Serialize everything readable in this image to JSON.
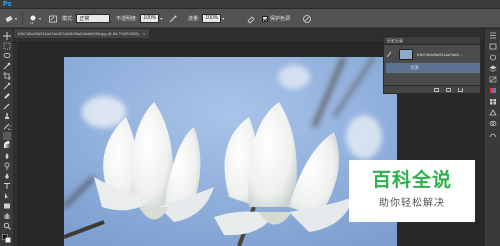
{
  "app": {
    "logo": "Ps"
  },
  "options_bar": {
    "mode_label": "模式:",
    "mode_value": "正常",
    "opacity_label": "不透明度:",
    "opacity_value": "100%",
    "flow_label": "流量:",
    "flow_value": "100%",
    "protect_label": "保护色调"
  },
  "document": {
    "tab_title": "b3b7d0a26d911ad7ab2b7a54b36a2d6de848d.jpg @ 66.7%(RGB/8)"
  },
  "history_panel": {
    "title": "历史记录",
    "snapshot_label": "b3b7d0a26d911ad7ab2...",
    "state_label": "打开"
  },
  "watermark": {
    "title": "百科全说",
    "subtitle": "助你轻松解决"
  },
  "colors": {
    "accent": "#31a8ff",
    "panel_selected": "#5d7190",
    "watermark_green": "#2bb24c",
    "sky": "#8fb0dc"
  }
}
